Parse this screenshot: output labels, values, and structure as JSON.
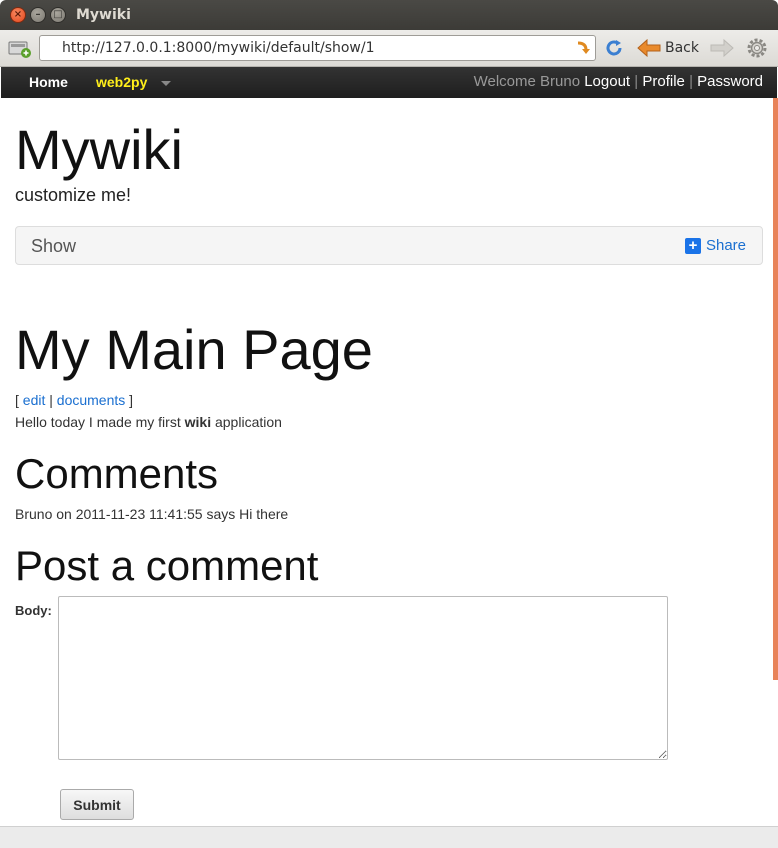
{
  "window": {
    "title": "Mywiki",
    "close_glyph": "×",
    "min_glyph": "–",
    "max_glyph": "□"
  },
  "browser": {
    "url": "http://127.0.0.1:8000/mywiki/default/show/1",
    "back_label": "Back",
    "icons": [
      "page-icon",
      "url-go-icon",
      "reload-icon",
      "back-arrow-icon",
      "forward-icon",
      "gear-icon"
    ]
  },
  "topbar": {
    "home_label": "Home",
    "brand_label": "web2py",
    "welcome_text": "Welcome Bruno",
    "logout_label": "Logout",
    "separator": "|",
    "profile_label": "Profile",
    "password_label": "Password"
  },
  "header": {
    "title": "Mywiki",
    "subtitle": "customize me!"
  },
  "breadcrumb": {
    "label": "Show",
    "share_label": "Share",
    "share_glyph": "+"
  },
  "page": {
    "heading": "My Main Page",
    "bracket_open": "[",
    "edit_label": "edit",
    "link_separator": "|",
    "documents_label": "documents",
    "bracket_close": "]",
    "body_prefix": "Hello today I made my first",
    "body_bold": "wiki",
    "body_suffix": "application"
  },
  "comments": {
    "heading": "Comments",
    "items": [
      {
        "text": "Bruno on 2011-11-23 11:41:55 says Hi there"
      }
    ]
  },
  "post_comment": {
    "heading": "Post a comment",
    "body_label": "Body:",
    "body_value": "",
    "submit_label": "Submit"
  },
  "colors": {
    "brand_yellow": "#ffef1a",
    "link_blue": "#1a6fd0",
    "topbar_dark": "#1e1e1e",
    "scroll_accent": "#e8835a"
  }
}
